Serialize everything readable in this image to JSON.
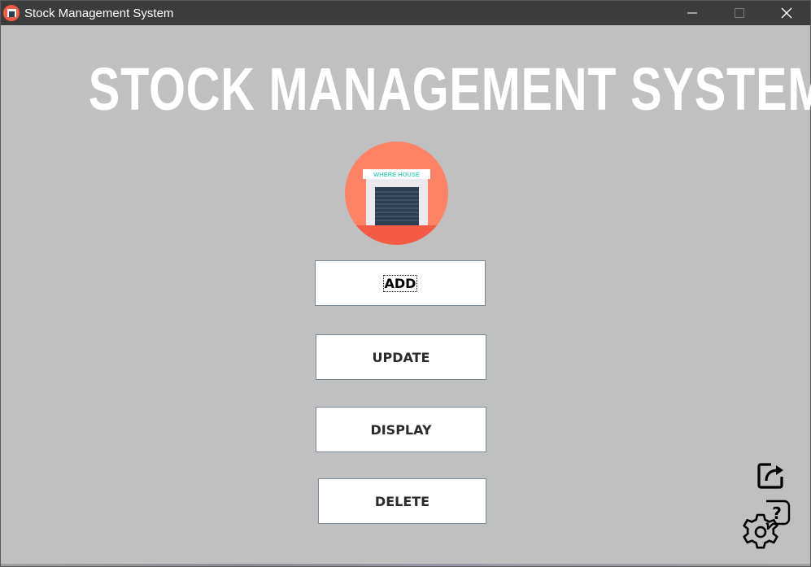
{
  "window": {
    "title": "Stock Management System",
    "controls": {
      "minimize_icon": "minimize-icon",
      "maximize_icon": "maximize-icon",
      "close_icon": "close-icon"
    }
  },
  "header": {
    "title": "STOCK MANAGEMENT SYSTEM"
  },
  "logo": {
    "sign_text": "WHERE HOUSE",
    "colors": {
      "circle": "#fe8266",
      "base": "#f45b45",
      "sign_text": "#4fd6c0",
      "door": "#2d3e50"
    }
  },
  "menu": {
    "add_label": "ADD",
    "update_label": "UPDATE",
    "display_label": "DISPLAY",
    "delete_label": "DELETE"
  },
  "icons": {
    "share": "share-icon",
    "settings_help": "settings-help-icon"
  },
  "colors": {
    "background": "#c0c0c0",
    "titlebar": "#3c3c3c",
    "title_text": "#ffffff",
    "button_border": "#7a8796"
  }
}
